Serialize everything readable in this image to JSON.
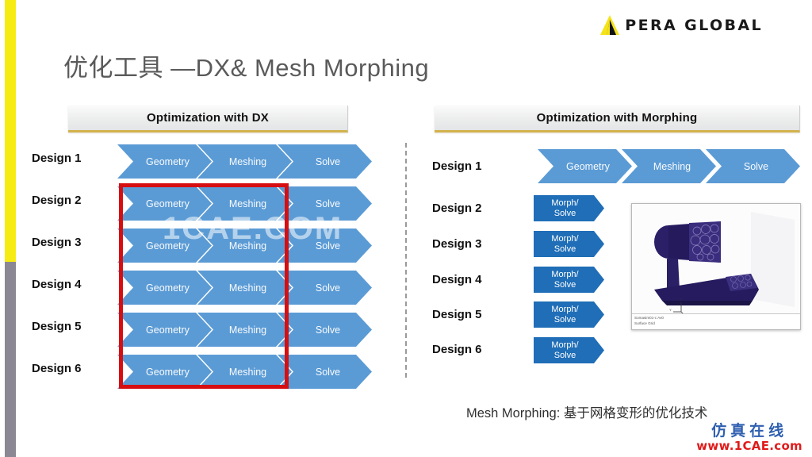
{
  "slide": {
    "title": "优化工具 —DX& Mesh Morphing",
    "caption": "Mesh Morphing: 基于网格变形的优化技术"
  },
  "logo": {
    "text": "PERA GLOBAL",
    "mark_icon": "pera-triangle-icon",
    "mark_color_primary": "#f5e31a",
    "mark_color_secondary": "#111111"
  },
  "accents": {
    "edge_yellow": "#f6ec13",
    "edge_gray": "#8b8893",
    "header_underline": "#d3b24c",
    "chevron_blue": "#5b9bd5",
    "morph_blue": "#1f6eb7",
    "highlight_red": "#d60e12"
  },
  "left_panel": {
    "header": "Optimization with DX",
    "designs": [
      "Design 1",
      "Design 2",
      "Design 3",
      "Design 4",
      "Design 5",
      "Design 6"
    ],
    "stages": [
      "Geometry",
      "Meshing",
      "Solve"
    ],
    "highlight_note": "red-box-around-geometry-and-meshing-for-designs-2-to-6"
  },
  "right_panel": {
    "header": "Optimization with Morphing",
    "designs": [
      "Design 1",
      "Design 2",
      "Design 3",
      "Design 4",
      "Design 5",
      "Design 6"
    ],
    "first_row_stages": [
      "Geometry",
      "Meshing",
      "Solve"
    ],
    "morph_label_line1": "Morph/",
    "morph_label_line2": "Solve",
    "thumbnail": {
      "name": "cfd-surface-grid-thumbnail",
      "caption_line1": "Somasim01-c Av0",
      "caption_line2": "Surface Grid"
    }
  },
  "watermarks": {
    "center": "1CAE.COM",
    "bottom_cn": "仿真在线",
    "bottom_url": "www.1CAE.com"
  }
}
